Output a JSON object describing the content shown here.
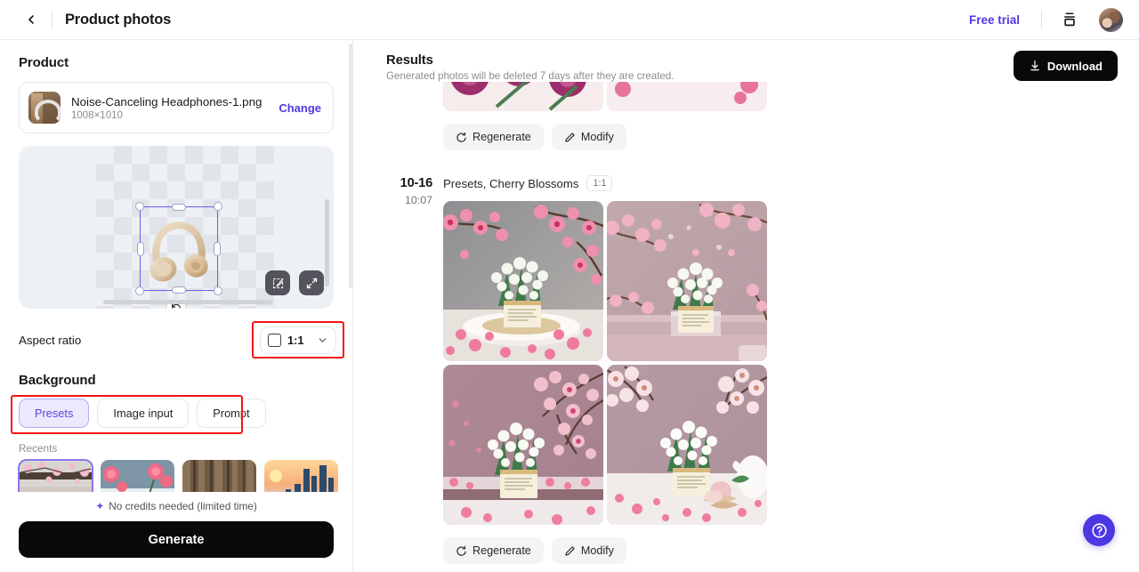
{
  "header": {
    "back_icon": "chevron-left-icon",
    "title": "Product photos",
    "free_trial": "Free trial",
    "layers_icon": "layers-icon",
    "avatar": "user-avatar"
  },
  "left_panel": {
    "product_section_title": "Product",
    "product": {
      "file_name": "Noise-Canceling Headphones-1.png",
      "dimensions": "1008×1010",
      "change_label": "Change"
    },
    "canvas": {
      "rotate_icon": "rotate-icon",
      "tools": [
        {
          "name": "magic-edit-icon",
          "label": "Magic edit"
        },
        {
          "name": "expand-icon",
          "label": "Expand"
        }
      ]
    },
    "aspect_ratio": {
      "label": "Aspect ratio",
      "value": "1:1",
      "icon": "square-icon",
      "chevron": "chevron-down-icon"
    },
    "background": {
      "section_title": "Background",
      "tabs": [
        {
          "label": "Presets",
          "active": true
        },
        {
          "label": "Image input",
          "active": false
        },
        {
          "label": "Prompt",
          "active": false
        }
      ],
      "recents_label": "Recents",
      "recents": [
        {
          "name": "cherry-blossoms",
          "selected": true
        },
        {
          "name": "pink-carnations",
          "selected": false
        },
        {
          "name": "wooden-slats",
          "selected": false
        },
        {
          "name": "city-sunset",
          "selected": false
        }
      ]
    },
    "footer": {
      "credits_icon": "sparkle-icon",
      "credits_note": "No credits needed (limited time)",
      "generate_label": "Generate"
    }
  },
  "right_panel": {
    "title": "Results",
    "subtitle": "Generated photos will be deleted 7 days after they are created.",
    "download": {
      "label": "Download",
      "icon": "download-icon"
    },
    "groups": [
      {
        "clipped": true,
        "actions": [
          {
            "label": "Regenerate",
            "icon": "regenerate-icon"
          },
          {
            "label": "Modify",
            "icon": "pencil-icon"
          }
        ]
      },
      {
        "date": "10-16",
        "time": "10:07",
        "description": "Presets, Cherry Blossoms",
        "ratio_badge": "1:1",
        "images": [
          {
            "name": "cherry-blossom-podium-gray"
          },
          {
            "name": "cherry-blossom-mauve-step"
          },
          {
            "name": "cherry-blossom-pink-shelf"
          },
          {
            "name": "cherry-blossom-white-table"
          }
        ],
        "actions": [
          {
            "label": "Regenerate",
            "icon": "regenerate-icon"
          },
          {
            "label": "Modify",
            "icon": "pencil-icon"
          }
        ]
      }
    ],
    "help": {
      "icon": "help-circle-icon"
    }
  },
  "colors": {
    "accent": "#4f39e6",
    "accent_soft": "#ece9fe",
    "highlight": "#f51414",
    "dark": "#09090b"
  }
}
